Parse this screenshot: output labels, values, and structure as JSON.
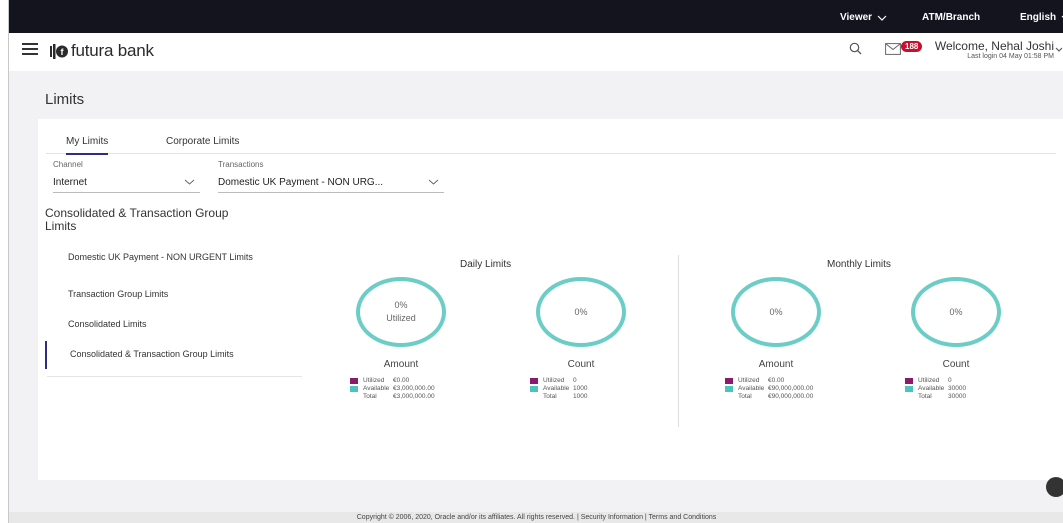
{
  "topbar": {
    "viewer": "Viewer",
    "atm_branch": "ATM/Branch",
    "language": "English"
  },
  "brand": {
    "name": "futura bank"
  },
  "header": {
    "notification_count": "188",
    "welcome": "Welcome, Nehal Joshi",
    "last_login": "Last login 04 May 01:58 PM"
  },
  "page": {
    "title": "Limits"
  },
  "tabs": [
    {
      "label": "My Limits",
      "active": true
    },
    {
      "label": "Corporate Limits",
      "active": false
    }
  ],
  "filters": {
    "channel": {
      "label": "Channel",
      "value": "Internet"
    },
    "transactions": {
      "label": "Transactions",
      "value": "Domestic UK Payment - NON URG..."
    }
  },
  "section": {
    "title": "Consolidated & Transaction Group Limits"
  },
  "leftnav": [
    {
      "label": "Domestic UK Payment - NON URGENT Limits",
      "active": false
    },
    {
      "label": "Transaction Group Limits",
      "active": false
    },
    {
      "label": "Consolidated Limits",
      "active": false
    },
    {
      "label": "Consolidated & Transaction Group Limits",
      "active": true
    }
  ],
  "colors": {
    "ring": "#6ccdc7",
    "utilized": "#8b1a6b",
    "available": "#4cc3c0",
    "accent": "#2f2c86"
  },
  "daily": {
    "title": "Daily Limits",
    "amount": {
      "center_pct": "0%",
      "center_sub": "Utilized",
      "label": "Amount",
      "legend": [
        {
          "k": "Utilized",
          "v": "€0.00"
        },
        {
          "k": "Available",
          "v": "€3,000,000.00"
        },
        {
          "k": "Total",
          "v": "€3,000,000.00"
        }
      ]
    },
    "count": {
      "center_pct": "0%",
      "label": "Count",
      "legend": [
        {
          "k": "Utilized",
          "v": "0"
        },
        {
          "k": "Available",
          "v": "1000"
        },
        {
          "k": "Total",
          "v": "1000"
        }
      ]
    }
  },
  "monthly": {
    "title": "Monthly Limits",
    "amount": {
      "center_pct": "0%",
      "label": "Amount",
      "legend": [
        {
          "k": "Utilized",
          "v": "€0.00"
        },
        {
          "k": "Available",
          "v": "€90,000,000.00"
        },
        {
          "k": "Total",
          "v": "€90,000,000.00"
        }
      ]
    },
    "count": {
      "center_pct": "0%",
      "label": "Count",
      "legend": [
        {
          "k": "Utilized",
          "v": "0"
        },
        {
          "k": "Available",
          "v": "30000"
        },
        {
          "k": "Total",
          "v": "30000"
        }
      ]
    }
  },
  "footer": {
    "text": "Copyright © 2006, 2020, Oracle and/or its affiliates. All rights reserved. | Security Information | Terms and Conditions"
  }
}
